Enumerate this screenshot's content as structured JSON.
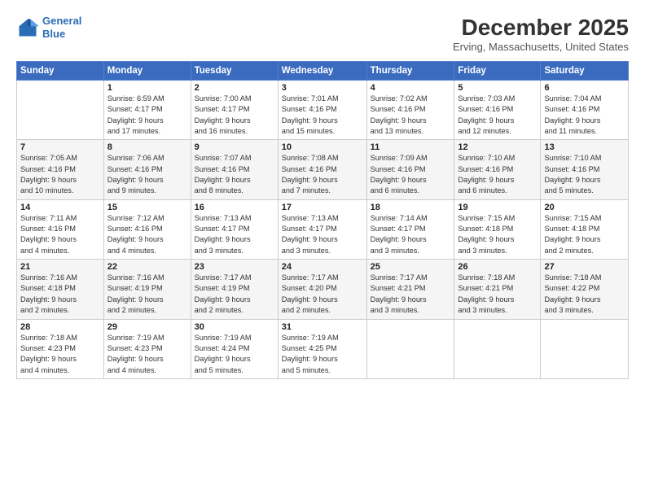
{
  "header": {
    "logo_line1": "General",
    "logo_line2": "Blue",
    "month": "December 2025",
    "location": "Erving, Massachusetts, United States"
  },
  "weekdays": [
    "Sunday",
    "Monday",
    "Tuesday",
    "Wednesday",
    "Thursday",
    "Friday",
    "Saturday"
  ],
  "weeks": [
    [
      {
        "day": "",
        "info": ""
      },
      {
        "day": "1",
        "info": "Sunrise: 6:59 AM\nSunset: 4:17 PM\nDaylight: 9 hours\nand 17 minutes."
      },
      {
        "day": "2",
        "info": "Sunrise: 7:00 AM\nSunset: 4:17 PM\nDaylight: 9 hours\nand 16 minutes."
      },
      {
        "day": "3",
        "info": "Sunrise: 7:01 AM\nSunset: 4:16 PM\nDaylight: 9 hours\nand 15 minutes."
      },
      {
        "day": "4",
        "info": "Sunrise: 7:02 AM\nSunset: 4:16 PM\nDaylight: 9 hours\nand 13 minutes."
      },
      {
        "day": "5",
        "info": "Sunrise: 7:03 AM\nSunset: 4:16 PM\nDaylight: 9 hours\nand 12 minutes."
      },
      {
        "day": "6",
        "info": "Sunrise: 7:04 AM\nSunset: 4:16 PM\nDaylight: 9 hours\nand 11 minutes."
      }
    ],
    [
      {
        "day": "7",
        "info": "Sunrise: 7:05 AM\nSunset: 4:16 PM\nDaylight: 9 hours\nand 10 minutes."
      },
      {
        "day": "8",
        "info": "Sunrise: 7:06 AM\nSunset: 4:16 PM\nDaylight: 9 hours\nand 9 minutes."
      },
      {
        "day": "9",
        "info": "Sunrise: 7:07 AM\nSunset: 4:16 PM\nDaylight: 9 hours\nand 8 minutes."
      },
      {
        "day": "10",
        "info": "Sunrise: 7:08 AM\nSunset: 4:16 PM\nDaylight: 9 hours\nand 7 minutes."
      },
      {
        "day": "11",
        "info": "Sunrise: 7:09 AM\nSunset: 4:16 PM\nDaylight: 9 hours\nand 6 minutes."
      },
      {
        "day": "12",
        "info": "Sunrise: 7:10 AM\nSunset: 4:16 PM\nDaylight: 9 hours\nand 6 minutes."
      },
      {
        "day": "13",
        "info": "Sunrise: 7:10 AM\nSunset: 4:16 PM\nDaylight: 9 hours\nand 5 minutes."
      }
    ],
    [
      {
        "day": "14",
        "info": "Sunrise: 7:11 AM\nSunset: 4:16 PM\nDaylight: 9 hours\nand 4 minutes."
      },
      {
        "day": "15",
        "info": "Sunrise: 7:12 AM\nSunset: 4:16 PM\nDaylight: 9 hours\nand 4 minutes."
      },
      {
        "day": "16",
        "info": "Sunrise: 7:13 AM\nSunset: 4:17 PM\nDaylight: 9 hours\nand 3 minutes."
      },
      {
        "day": "17",
        "info": "Sunrise: 7:13 AM\nSunset: 4:17 PM\nDaylight: 9 hours\nand 3 minutes."
      },
      {
        "day": "18",
        "info": "Sunrise: 7:14 AM\nSunset: 4:17 PM\nDaylight: 9 hours\nand 3 minutes."
      },
      {
        "day": "19",
        "info": "Sunrise: 7:15 AM\nSunset: 4:18 PM\nDaylight: 9 hours\nand 3 minutes."
      },
      {
        "day": "20",
        "info": "Sunrise: 7:15 AM\nSunset: 4:18 PM\nDaylight: 9 hours\nand 2 minutes."
      }
    ],
    [
      {
        "day": "21",
        "info": "Sunrise: 7:16 AM\nSunset: 4:18 PM\nDaylight: 9 hours\nand 2 minutes."
      },
      {
        "day": "22",
        "info": "Sunrise: 7:16 AM\nSunset: 4:19 PM\nDaylight: 9 hours\nand 2 minutes."
      },
      {
        "day": "23",
        "info": "Sunrise: 7:17 AM\nSunset: 4:19 PM\nDaylight: 9 hours\nand 2 minutes."
      },
      {
        "day": "24",
        "info": "Sunrise: 7:17 AM\nSunset: 4:20 PM\nDaylight: 9 hours\nand 2 minutes."
      },
      {
        "day": "25",
        "info": "Sunrise: 7:17 AM\nSunset: 4:21 PM\nDaylight: 9 hours\nand 3 minutes."
      },
      {
        "day": "26",
        "info": "Sunrise: 7:18 AM\nSunset: 4:21 PM\nDaylight: 9 hours\nand 3 minutes."
      },
      {
        "day": "27",
        "info": "Sunrise: 7:18 AM\nSunset: 4:22 PM\nDaylight: 9 hours\nand 3 minutes."
      }
    ],
    [
      {
        "day": "28",
        "info": "Sunrise: 7:18 AM\nSunset: 4:23 PM\nDaylight: 9 hours\nand 4 minutes."
      },
      {
        "day": "29",
        "info": "Sunrise: 7:19 AM\nSunset: 4:23 PM\nDaylight: 9 hours\nand 4 minutes."
      },
      {
        "day": "30",
        "info": "Sunrise: 7:19 AM\nSunset: 4:24 PM\nDaylight: 9 hours\nand 5 minutes."
      },
      {
        "day": "31",
        "info": "Sunrise: 7:19 AM\nSunset: 4:25 PM\nDaylight: 9 hours\nand 5 minutes."
      },
      {
        "day": "",
        "info": ""
      },
      {
        "day": "",
        "info": ""
      },
      {
        "day": "",
        "info": ""
      }
    ]
  ]
}
